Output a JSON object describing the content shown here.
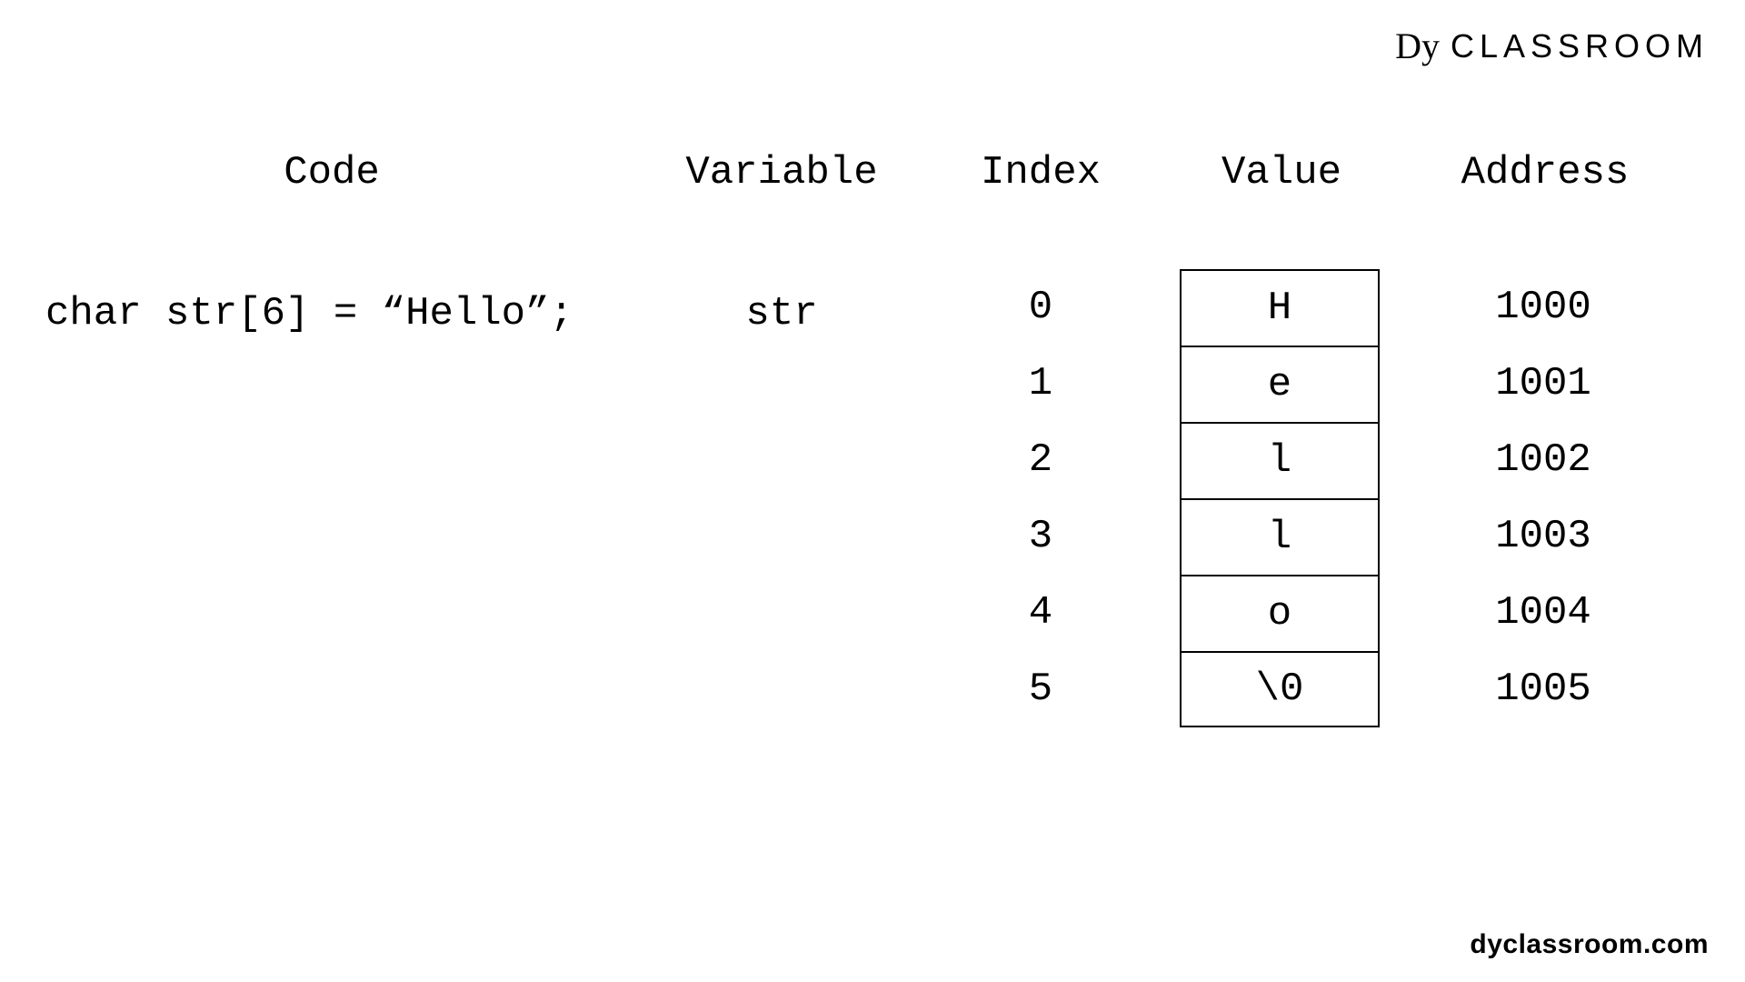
{
  "brand": {
    "mark": "Dy",
    "name": "CLASSROOM"
  },
  "headers": {
    "code": "Code",
    "variable": "Variable",
    "index": "Index",
    "value": "Value",
    "address": "Address"
  },
  "code_line": "char str[6] = “Hello”;",
  "variable_name": "str",
  "memory": [
    {
      "index": "0",
      "value": "H",
      "address": "1000"
    },
    {
      "index": "1",
      "value": "e",
      "address": "1001"
    },
    {
      "index": "2",
      "value": "l",
      "address": "1002"
    },
    {
      "index": "3",
      "value": "l",
      "address": "1003"
    },
    {
      "index": "4",
      "value": "o",
      "address": "1004"
    },
    {
      "index": "5",
      "value": "\\0",
      "address": "1005"
    }
  ],
  "footer": "dyclassroom.com"
}
